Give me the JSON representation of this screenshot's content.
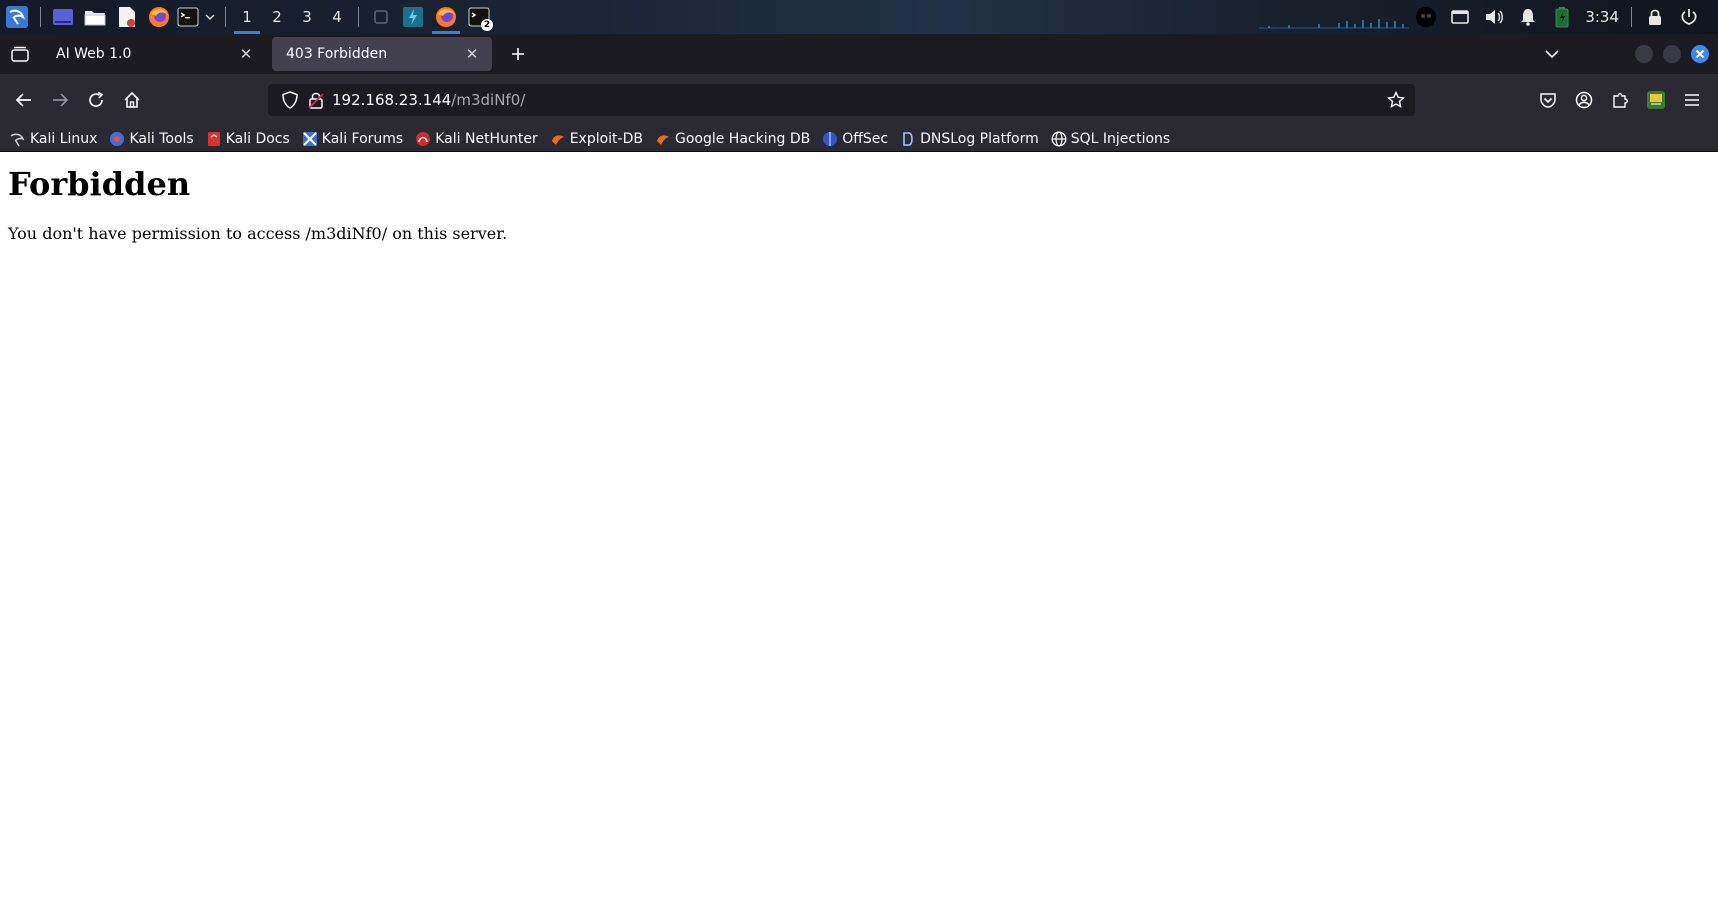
{
  "taskbar": {
    "workspaces": [
      "1",
      "2",
      "3",
      "4"
    ],
    "active_workspace": "1",
    "terminal_badge": "2",
    "clock": "3:34"
  },
  "tabs": [
    {
      "title": "AI Web 1.0",
      "selected": false
    },
    {
      "title": "403 Forbidden",
      "selected": true
    }
  ],
  "navbar": {
    "url_host": "192.168.23.144",
    "url_path": "/m3diNf0/"
  },
  "bookmarks": [
    {
      "label": "Kali Linux",
      "icon": "kali-dragon-icon"
    },
    {
      "label": "Kali Tools",
      "icon": "kali-tools-icon"
    },
    {
      "label": "Kali Docs",
      "icon": "kali-docs-icon"
    },
    {
      "label": "Kali Forums",
      "icon": "kali-forums-icon"
    },
    {
      "label": "Kali NetHunter",
      "icon": "nethunter-icon"
    },
    {
      "label": "Exploit-DB",
      "icon": "exploit-db-icon"
    },
    {
      "label": "Google Hacking DB",
      "icon": "ghdb-icon"
    },
    {
      "label": "OffSec",
      "icon": "offsec-icon"
    },
    {
      "label": "DNSLog Platform",
      "icon": "dnslog-icon"
    },
    {
      "label": "SQL Injections",
      "icon": "globe-icon"
    }
  ],
  "page": {
    "heading": "Forbidden",
    "message": "You don't have permission to access /m3diNf0/ on this server."
  },
  "colors": {
    "taskbar_accent": "#3d7bdc",
    "tabstrip_bg": "#1c1b22",
    "toolbar_bg": "#2b2a33",
    "selected_tab_bg": "#42414d"
  }
}
